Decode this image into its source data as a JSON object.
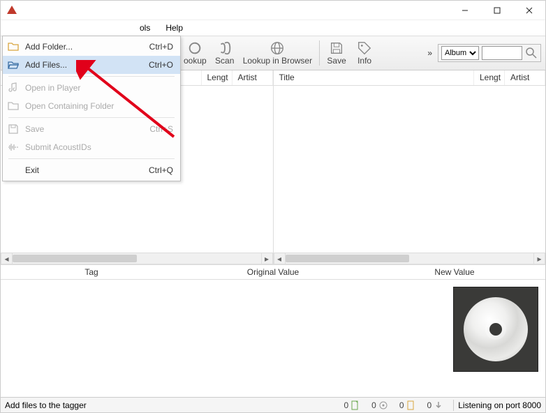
{
  "window": {
    "title": ""
  },
  "menubar": {
    "tools": "ols",
    "help": "Help"
  },
  "toolbar": {
    "lookup": "ookup",
    "scan": "Scan",
    "lookup_browser": "Lookup in Browser",
    "save": "Save",
    "info": "Info",
    "filter_options": [
      "Album"
    ],
    "filter_selected": "Album",
    "search_value": ""
  },
  "left_pane": {
    "cols": {
      "lengt": "Lengt",
      "artist": "Artist"
    }
  },
  "right_pane": {
    "cols": {
      "title": "Title",
      "lengt": "Lengt",
      "artist": "Artist"
    }
  },
  "tag_headers": {
    "tag": "Tag",
    "original": "Original Value",
    "new": "New Value"
  },
  "statusbar": {
    "text": "Add files to the tagger",
    "counts": [
      "0",
      "0",
      "0",
      "0"
    ],
    "port": "Listening on port 8000"
  },
  "menu": {
    "items": [
      {
        "icon": "folder-icon",
        "label": "Add Folder...",
        "shortcut": "Ctrl+D",
        "disabled": false,
        "gold": true
      },
      {
        "icon": "folder-open-icon",
        "label": "Add Files...",
        "shortcut": "Ctrl+O",
        "disabled": false,
        "highlight": true
      },
      {
        "sep": true
      },
      {
        "icon": "note-icon",
        "label": "Open in Player",
        "shortcut": "",
        "disabled": true
      },
      {
        "icon": "folder-icon",
        "label": "Open Containing Folder",
        "shortcut": "",
        "disabled": true
      },
      {
        "sep": true
      },
      {
        "icon": "save-icon",
        "label": "Save",
        "shortcut": "Ctrl+S",
        "disabled": true
      },
      {
        "icon": "wave-icon",
        "label": "Submit AcoustIDs",
        "shortcut": "",
        "disabled": true
      },
      {
        "sep": true
      },
      {
        "icon": "",
        "label": "Exit",
        "shortcut": "Ctrl+Q",
        "disabled": false
      }
    ]
  }
}
